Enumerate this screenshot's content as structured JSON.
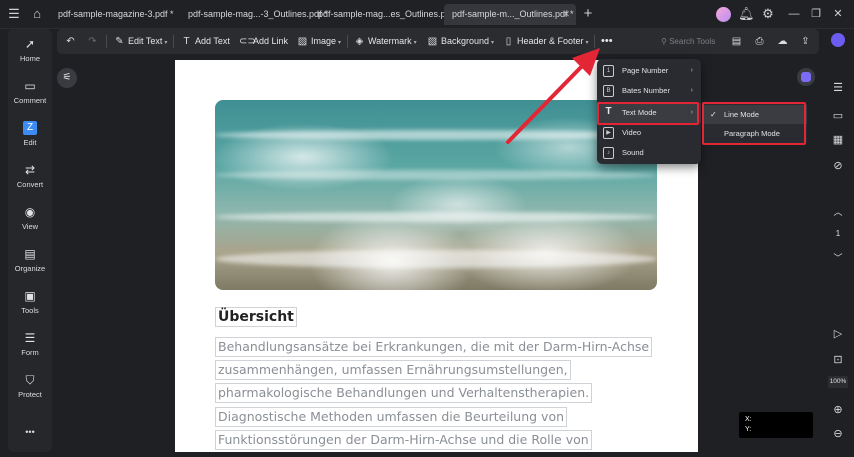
{
  "tabs": [
    {
      "label": "pdf-sample-magazine-3.pdf *",
      "active": false
    },
    {
      "label": "pdf-sample-mag...-3_Outlines.pdf *",
      "active": false
    },
    {
      "label": "pdf-sample-mag...es_Outlines.pdf *",
      "active": false
    },
    {
      "label": "pdf-sample-m..._Outlines.pdf *",
      "active": true
    }
  ],
  "sidebar": {
    "items": [
      {
        "label": "Home",
        "icon": "rocket-icon"
      },
      {
        "label": "Comment",
        "icon": "comment-icon"
      },
      {
        "label": "Edit",
        "icon": "edit-icon"
      },
      {
        "label": "Convert",
        "icon": "convert-icon"
      },
      {
        "label": "View",
        "icon": "eye-icon"
      },
      {
        "label": "Organize",
        "icon": "organize-icon"
      },
      {
        "label": "Tools",
        "icon": "toolbox-icon"
      },
      {
        "label": "Form",
        "icon": "form-icon"
      },
      {
        "label": "Protect",
        "icon": "shield-icon"
      }
    ],
    "more": "•••"
  },
  "toolbar": {
    "edit_text": "Edit Text",
    "add_text": "Add Text",
    "add_link": "Add Link",
    "image": "Image",
    "watermark": "Watermark",
    "background": "Background",
    "header_footer": "Header & Footer",
    "more": "•••",
    "search_placeholder": "Search Tools"
  },
  "menu": {
    "items": [
      {
        "label": "Page Number",
        "has_sub": true,
        "highlighted": false
      },
      {
        "label": "Bates Number",
        "has_sub": true,
        "highlighted": false
      },
      {
        "label": "Text Mode",
        "has_sub": true,
        "highlighted": true
      },
      {
        "label": "Video",
        "has_sub": false,
        "highlighted": false
      },
      {
        "label": "Sound",
        "has_sub": false,
        "highlighted": false
      }
    ]
  },
  "submenu": {
    "items": [
      {
        "label": "Line Mode",
        "checked": true
      },
      {
        "label": "Paragraph Mode",
        "checked": false
      }
    ]
  },
  "document": {
    "heading": "Übersicht",
    "lines": [
      "Behandlungsansätze bei Erkrankungen, die mit der Darm-Hirn-Achse",
      "zusammenhängen, umfassen Ernährungsumstellungen,",
      "pharmakologische Behandlungen und Verhaltenstherapien.",
      "Diagnostische Methoden umfassen die Beurteilung von",
      "Funktionsstörungen der Darm-Hirn-Achse und die Rolle von"
    ]
  },
  "rightbar": {
    "page": "1",
    "zoom": "100%"
  },
  "coords": {
    "x_label": "X:",
    "y_label": "Y:"
  },
  "colors": {
    "highlight_red": "#e32636",
    "accent_purple": "#7b6cf6"
  }
}
